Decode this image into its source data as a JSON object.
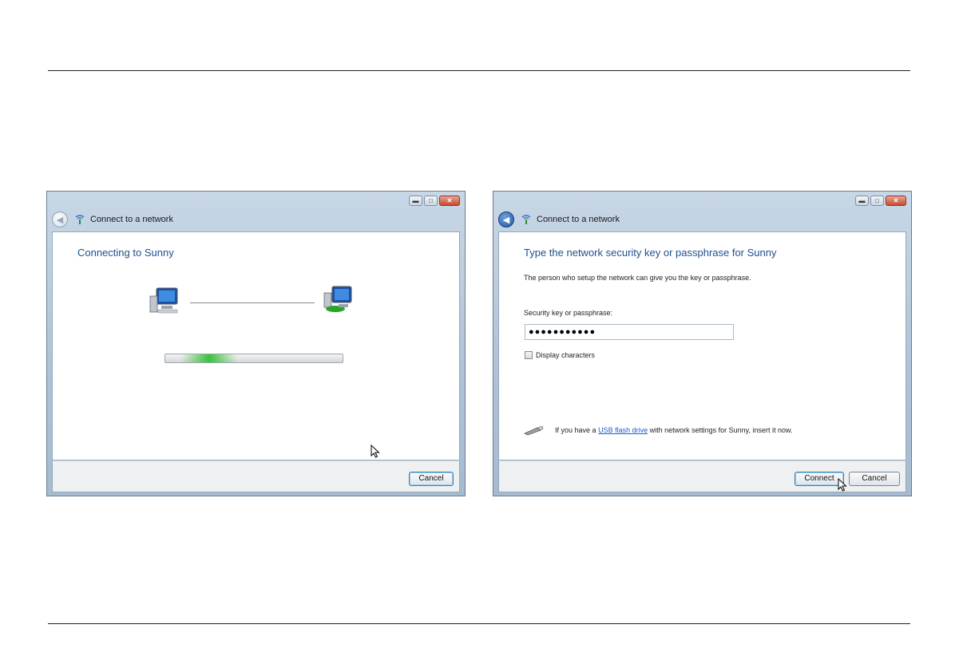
{
  "left_window": {
    "title": "Connect to a network",
    "heading": "Connecting to Sunny",
    "progress": 0.35,
    "cancel_label": "Cancel"
  },
  "right_window": {
    "title": "Connect to a network",
    "heading": "Type the network security key or passphrase for Sunny",
    "description": "The person who setup the network can give you the key or passphrase.",
    "field_label": "Security key or passphrase:",
    "password_value": "●●●●●●●●●●●",
    "checkbox_label": "Display characters",
    "usb_prefix": "If you have a",
    "usb_link": "USB flash drive",
    "usb_suffix": "with network settings for Sunny, insert it now.",
    "connect_label": "Connect",
    "cancel_label": "Cancel"
  },
  "colors": {
    "heading_blue": "#1e4f8f",
    "link_blue": "#1a5dc9",
    "progress_green": "#39c339"
  },
  "icons": [
    "back-arrow-icon",
    "wireless-network-icon",
    "minimize-icon",
    "maximize-icon",
    "close-icon",
    "computer-icon",
    "network-computer-icon",
    "usb-drive-icon",
    "mouse-cursor-icon"
  ]
}
